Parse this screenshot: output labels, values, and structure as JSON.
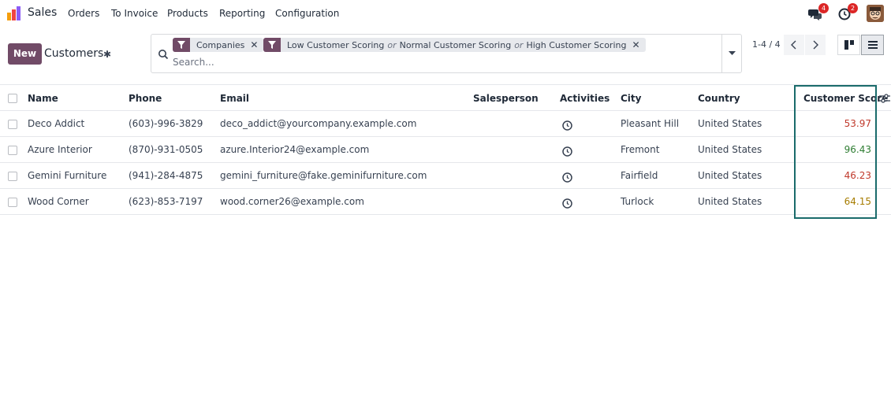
{
  "nav": {
    "app_name": "Sales",
    "menu": [
      "Orders",
      "To Invoice",
      "Products",
      "Reporting",
      "Configuration"
    ],
    "messages_badge": "4",
    "activities_badge": "2"
  },
  "control": {
    "new_label": "New",
    "title": "Customers",
    "search_placeholder": "Search...",
    "facets": {
      "f1": "Companies",
      "f2a": "Low Customer Scoring",
      "f2b": "Normal Customer Scoring",
      "f2c": "High Customer Scoring",
      "or": "or"
    },
    "pager": "1-4 / 4"
  },
  "table": {
    "headers": {
      "name": "Name",
      "phone": "Phone",
      "email": "Email",
      "salesperson": "Salesperson",
      "activities": "Activities",
      "city": "City",
      "country": "Country",
      "score": "Customer Score"
    },
    "rows": [
      {
        "name": "Deco Addict",
        "phone": "(603)-996-3829",
        "email": "deco_addict@yourcompany.example.com",
        "salesperson": "",
        "city": "Pleasant Hill",
        "country": "United States",
        "score": "53.97",
        "score_color": "#c0392b"
      },
      {
        "name": "Azure Interior",
        "phone": "(870)-931-0505",
        "email": "azure.Interior24@example.com",
        "salesperson": "",
        "city": "Fremont",
        "country": "United States",
        "score": "96.43",
        "score_color": "#2e7d32"
      },
      {
        "name": "Gemini Furniture",
        "phone": "(941)-284-4875",
        "email": "gemini_furniture@fake.geminifurniture.com",
        "salesperson": "",
        "city": "Fairfield",
        "country": "United States",
        "score": "46.23",
        "score_color": "#c0392b"
      },
      {
        "name": "Wood Corner",
        "phone": "(623)-853-7197",
        "email": "wood.corner26@example.com",
        "salesperson": "",
        "city": "Turlock",
        "country": "United States",
        "score": "64.15",
        "score_color": "#a67c00"
      }
    ]
  },
  "colors": {
    "brand": "#714b67",
    "highlight_frame": "#1a6b6b",
    "badge": "#dc2626"
  }
}
